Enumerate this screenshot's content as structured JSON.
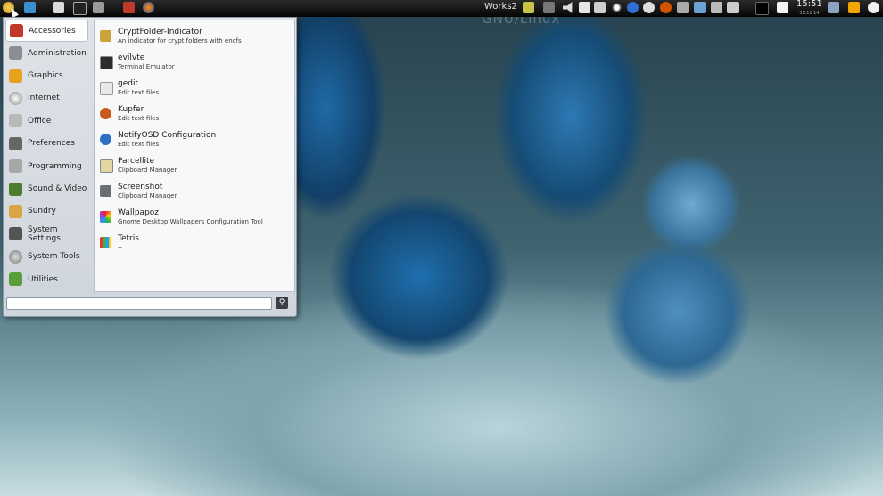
{
  "panel": {
    "workspace": "Works2",
    "clock_time": "15:51",
    "clock_date": "30.11.14"
  },
  "wallpaper": {
    "overlay_text": "GNU/Linux"
  },
  "menu": {
    "categories": [
      {
        "label": "Accessories",
        "icon": "accessories-icon"
      },
      {
        "label": "Administration",
        "icon": "administration-icon"
      },
      {
        "label": "Graphics",
        "icon": "graphics-icon"
      },
      {
        "label": "Internet",
        "icon": "internet-icon"
      },
      {
        "label": "Office",
        "icon": "office-icon"
      },
      {
        "label": "Preferences",
        "icon": "preferences-icon"
      },
      {
        "label": "Programming",
        "icon": "programming-icon"
      },
      {
        "label": "Sound & Video",
        "icon": "sound-video-icon"
      },
      {
        "label": "Sundry",
        "icon": "sundry-icon"
      },
      {
        "label": "System Settings",
        "icon": "system-settings-icon"
      },
      {
        "label": "System Tools",
        "icon": "system-tools-icon"
      },
      {
        "label": "Utilities",
        "icon": "utilities-icon"
      }
    ],
    "apps": [
      {
        "name": "CryptFolder-Indicator",
        "desc": "An indicator for crypt folders with encfs"
      },
      {
        "name": "evilvte",
        "desc": "Terminal Emulator"
      },
      {
        "name": "gedit",
        "desc": "Edit text files"
      },
      {
        "name": "Kupfer",
        "desc": "Edit text files"
      },
      {
        "name": "NotifyOSD Configuration",
        "desc": "Edit text files"
      },
      {
        "name": "Parcellite",
        "desc": "Clipboard Manager"
      },
      {
        "name": "Screenshot",
        "desc": "Clipboard Manager"
      },
      {
        "name": "Wallpapoz",
        "desc": "Gnome Desktop Wallpapers Configuration Tool"
      },
      {
        "name": "Tetris",
        "desc": "--"
      }
    ],
    "search": {
      "value": "",
      "placeholder": ""
    }
  },
  "colors": {
    "panel_bg": "#0b0b0b",
    "menu_bg": "#dfe3e8",
    "accent_border": "#8d98a6"
  }
}
